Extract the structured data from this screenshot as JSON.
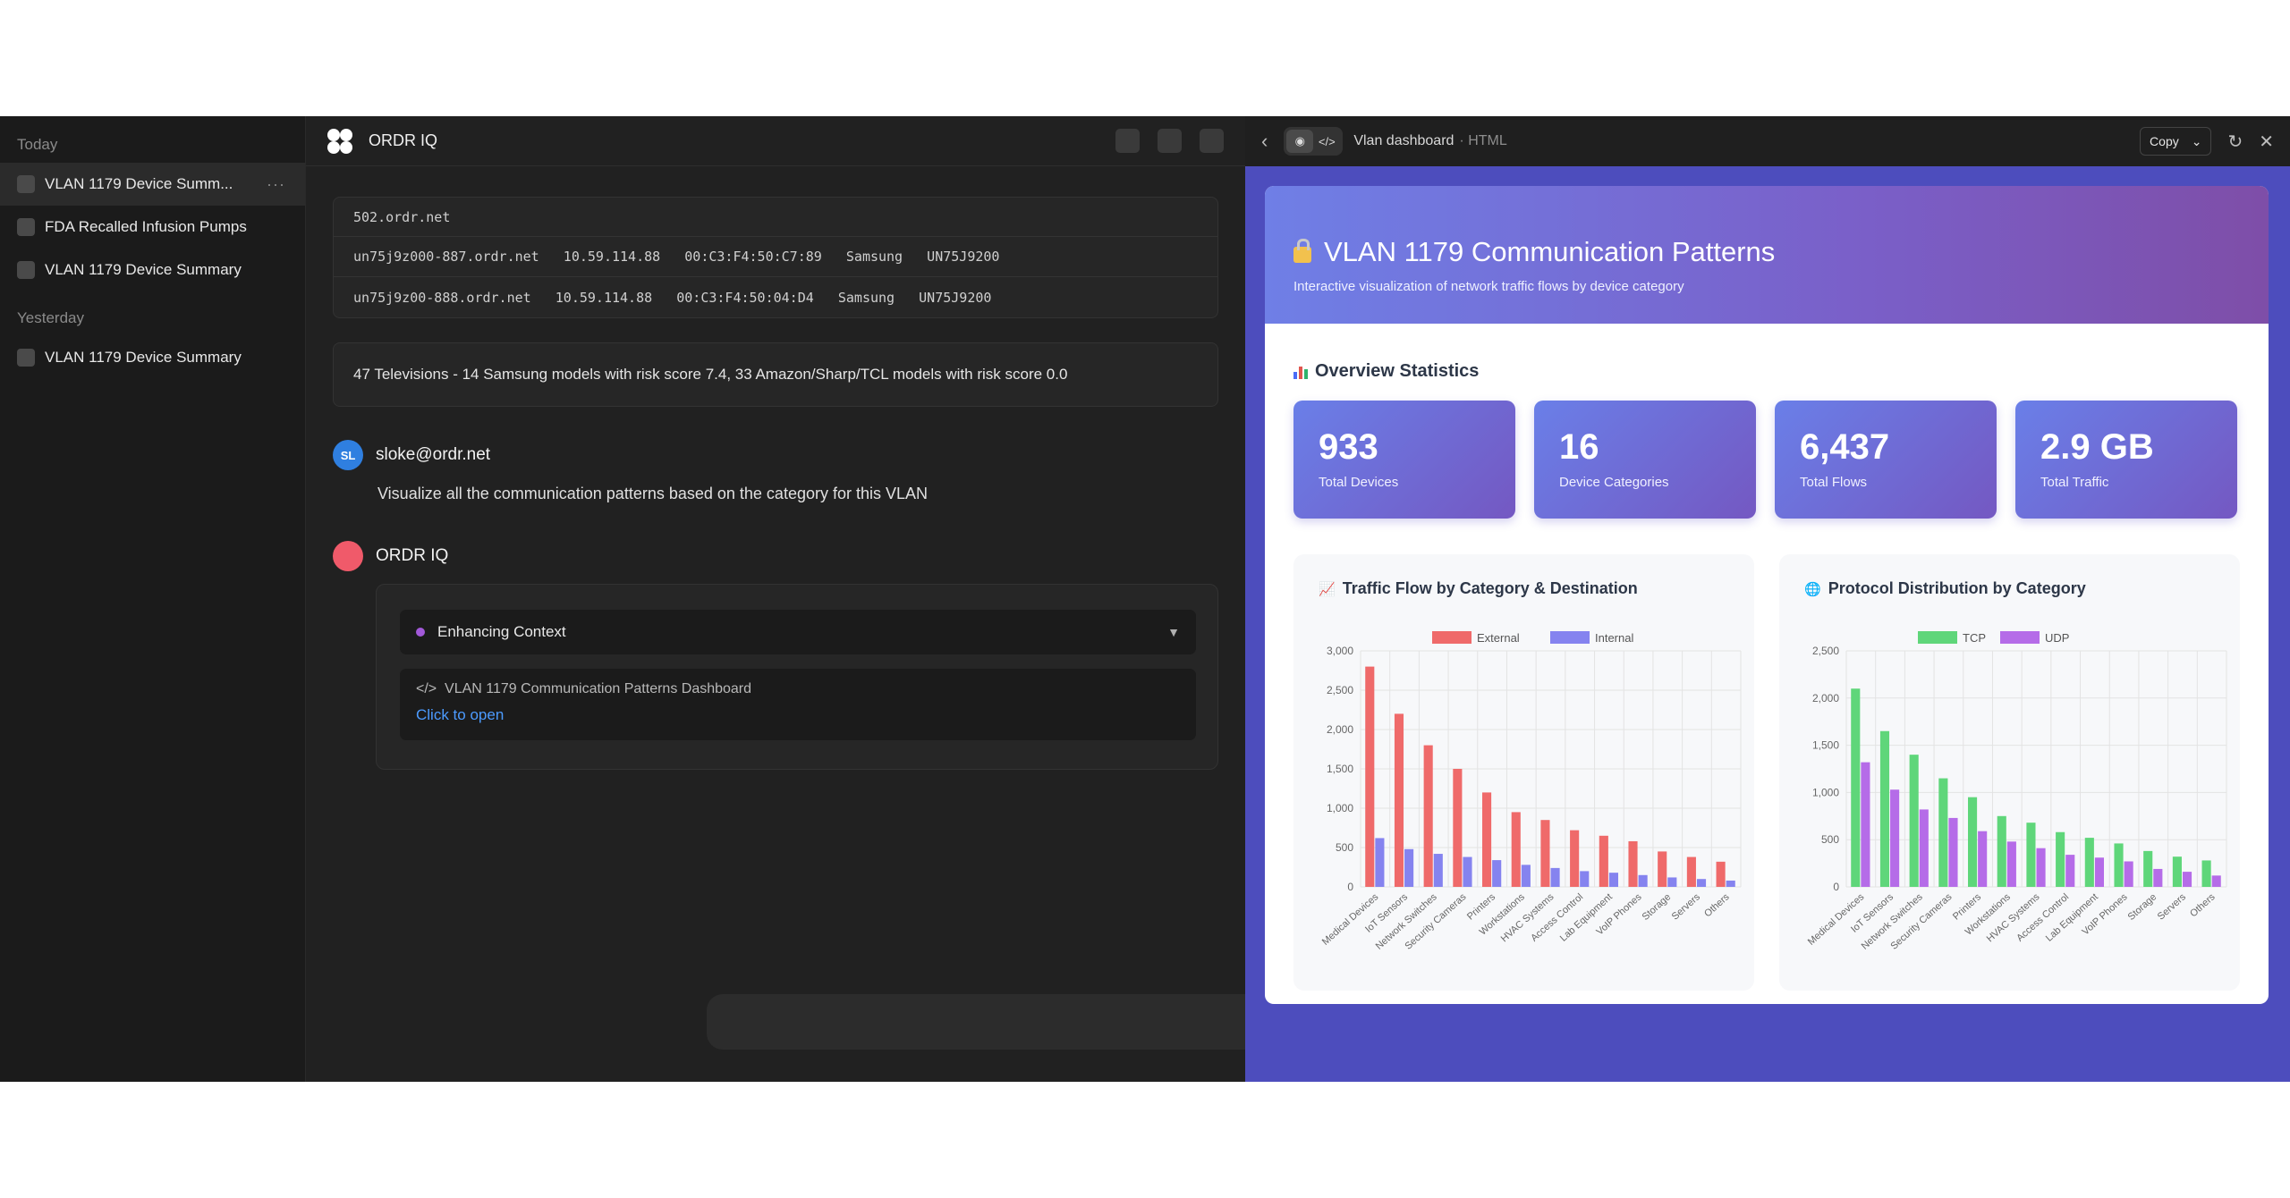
{
  "sidebar": {
    "today_label": "Today",
    "yesterday_label": "Yesterday",
    "today_items": [
      {
        "label": "VLAN 1179 Device Summ...",
        "more": "···"
      },
      {
        "label": "FDA Recalled Infusion Pumps"
      },
      {
        "label": "VLAN 1179 Device Summary"
      }
    ],
    "yesterday_items": [
      {
        "label": "VLAN 1179 Device Summary"
      }
    ]
  },
  "chat": {
    "title": "ORDR IQ",
    "code_rows": [
      "502.ordr.net",
      "un75j9z000-887.ordr.net   10.59.114.88   00:C3:F4:50:C7:89   Samsung   UN75J9200",
      "un75j9z00-888.ordr.net   10.59.114.88   00:C3:F4:50:04:D4   Samsung   UN75J9200"
    ],
    "summary": "47 Televisions - 14 Samsung models with risk score 7.4, 33 Amazon/Sharp/TCL models with risk score 0.0",
    "user": {
      "initials": "SL",
      "name": "sloke@ordr.net",
      "message": "Visualize all the communication patterns based on the category for this VLAN"
    },
    "assistant": {
      "name": "ORDR IQ",
      "context_label": "Enhancing Context",
      "caret": "▼",
      "artifact_icon": "</>",
      "artifact_title": "VLAN 1179 Communication Patterns Dashboard",
      "artifact_link": "Click to open"
    }
  },
  "preview": {
    "back": "‹",
    "eye": "◉",
    "code": "</>",
    "title": "Vlan dashboard",
    "format": "· HTML",
    "copy_label": "Copy",
    "copy_caret": "⌄",
    "refresh": "↻",
    "close": "✕"
  },
  "dashboard": {
    "title": "VLAN 1179 Communication Patterns",
    "subtitle": "Interactive visualization of network traffic flows by device category",
    "overview_title": "Overview Statistics",
    "stats": [
      {
        "value": "933",
        "label": "Total Devices"
      },
      {
        "value": "16",
        "label": "Device Categories"
      },
      {
        "value": "6,437",
        "label": "Total Flows"
      },
      {
        "value": "2.9 GB",
        "label": "Total Traffic"
      }
    ],
    "colors": {
      "external": "#ef6a6a",
      "internal": "#8583ef",
      "tcp": "#5fd67a",
      "udp": "#b56ce8"
    }
  },
  "chart_data": [
    {
      "type": "bar",
      "title": "Traffic Flow by Category & Destination",
      "title_icon": "chart-increasing-icon",
      "categories": [
        "Medical Devices",
        "IoT Sensors",
        "Network Switches",
        "Security Cameras",
        "Printers",
        "Workstations",
        "HVAC Systems",
        "Access Control",
        "Lab Equipment",
        "VoIP Phones",
        "Storage",
        "Servers",
        "Others"
      ],
      "series": [
        {
          "name": "External",
          "values": [
            2800,
            2200,
            1800,
            1500,
            1200,
            950,
            850,
            720,
            650,
            580,
            450,
            380,
            320
          ]
        },
        {
          "name": "Internal",
          "values": [
            620,
            480,
            420,
            380,
            340,
            280,
            240,
            200,
            180,
            150,
            120,
            100,
            80
          ]
        }
      ],
      "ylim": [
        0,
        3000
      ],
      "yticks": [
        "0",
        "500",
        "1,000",
        "1,500",
        "2,000",
        "2,500",
        "3,000"
      ],
      "legend": "top",
      "grid": true
    },
    {
      "type": "bar",
      "title": "Protocol Distribution by Category",
      "title_icon": "globe-icon",
      "categories": [
        "Medical Devices",
        "IoT Sensors",
        "Network Switches",
        "Security Cameras",
        "Printers",
        "Workstations",
        "HVAC Systems",
        "Access Control",
        "Lab Equipment",
        "VoIP Phones",
        "Storage",
        "Servers",
        "Others"
      ],
      "series": [
        {
          "name": "TCP",
          "values": [
            2100,
            1650,
            1400,
            1150,
            950,
            750,
            680,
            580,
            520,
            460,
            380,
            320,
            280
          ]
        },
        {
          "name": "UDP",
          "values": [
            1320,
            1030,
            820,
            730,
            590,
            480,
            410,
            340,
            310,
            270,
            190,
            160,
            120
          ]
        }
      ],
      "ylim": [
        0,
        2500
      ],
      "yticks": [
        "0",
        "500",
        "1,000",
        "1,500",
        "2,000",
        "2,500"
      ],
      "legend": "top",
      "grid": true
    }
  ]
}
